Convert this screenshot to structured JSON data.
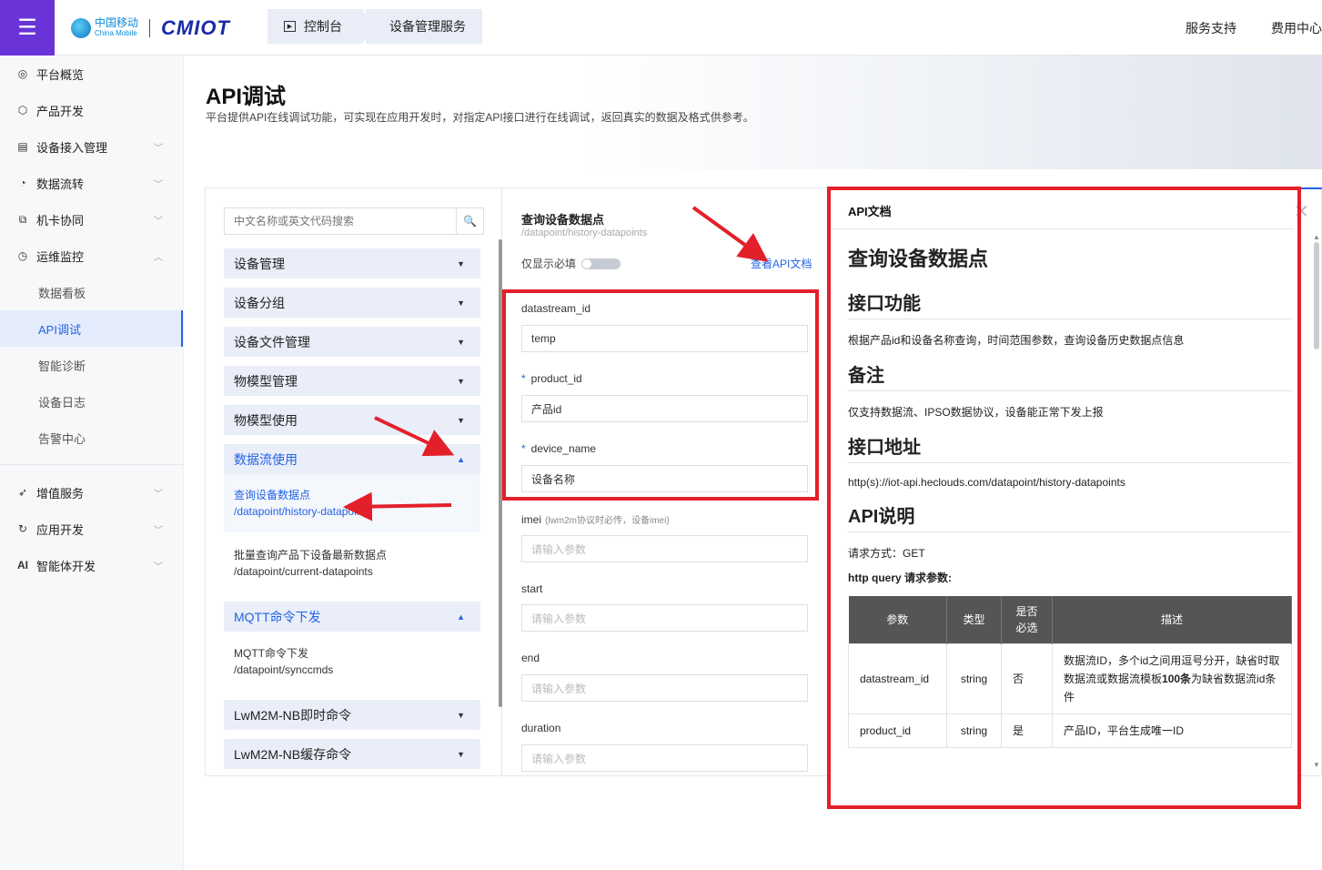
{
  "topbar": {
    "logo_cn": "中国移动",
    "logo_en": "China Mobile",
    "logo_cmiot": "CMIOT",
    "crumbs": [
      "控制台",
      "设备管理服务"
    ],
    "links": [
      "服务支持",
      "费用中心"
    ]
  },
  "sidebar": {
    "items": [
      {
        "label": "平台概览",
        "icon": "overview-icon",
        "chevron": false
      },
      {
        "label": "产品开发",
        "icon": "cube-icon",
        "chevron": false
      },
      {
        "label": "设备接入管理",
        "icon": "device-icon",
        "chevron": true
      },
      {
        "label": "数据流转",
        "icon": "flow-icon",
        "chevron": true
      },
      {
        "label": "机卡协同",
        "icon": "sim-icon",
        "chevron": true
      },
      {
        "label": "运维监控",
        "icon": "monitor-icon",
        "chevron": true,
        "expanded": true
      }
    ],
    "sub_items": [
      "数据看板",
      "API调试",
      "智能诊断",
      "设备日志",
      "告警中心"
    ],
    "active_sub": "API调试",
    "items2": [
      {
        "label": "增值服务",
        "icon": "send-icon"
      },
      {
        "label": "应用开发",
        "icon": "code-icon"
      },
      {
        "label": "智能体开发",
        "icon": "ai-icon"
      }
    ]
  },
  "page": {
    "title": "API调试",
    "desc": "平台提供API在线调试功能，可实现在应用开发时，对指定API接口进行在线调试，返回真实的数据及格式供参考。"
  },
  "left": {
    "search_placeholder": "中文名称或英文代码搜索",
    "groups": [
      "设备管理",
      "设备分组",
      "设备文件管理",
      "物模型管理",
      "物模型使用",
      "数据流使用"
    ],
    "open_items": [
      {
        "name": "查询设备数据点",
        "path": "/datapoint/history-datapoints"
      },
      {
        "name": "批量查询产品下设备最新数据点",
        "path": "/datapoint/current-datapoints"
      }
    ],
    "mqtt_group": "MQTT命令下发",
    "mqtt_item": {
      "name": "MQTT命令下发",
      "path": "/datapoint/synccmds"
    },
    "groups2": [
      "LwM2M-NB即时命令",
      "LwM2M-NB缓存命令"
    ]
  },
  "middle": {
    "title": "查询设备数据点",
    "path": "/datapoint/history-datapoints",
    "required_only": "仅显示必填",
    "api_doc_link": "查看API文档",
    "fields": [
      {
        "label": "datastream_id",
        "value": "temp",
        "required": false,
        "hint": ""
      },
      {
        "label": "product_id",
        "value": "产品id",
        "required": true,
        "hint": ""
      },
      {
        "label": "device_name",
        "value": "设备名称",
        "required": true,
        "hint": ""
      },
      {
        "label": "imei",
        "value": "请输入参数",
        "required": false,
        "hint": "(lwm2m协议时必传，设备imei)"
      },
      {
        "label": "start",
        "value": "请输入参数",
        "required": false,
        "hint": ""
      },
      {
        "label": "end",
        "value": "请输入参数",
        "required": false,
        "hint": ""
      },
      {
        "label": "duration",
        "value": "请输入参数",
        "required": false,
        "hint": ""
      }
    ]
  },
  "doc": {
    "header": "API文档",
    "title": "查询设备数据点",
    "h_func": "接口功能",
    "func": "根据产品id和设备名称查询，时间范围参数，查询设备历史数据点信息",
    "h_note": "备注",
    "note": "仅支持数据流、IPSO数据协议，设备能正常下发上报",
    "h_addr": "接口地址",
    "addr": "http(s)://iot-api.heclouds.com/datapoint/history-datapoints",
    "h_api": "API说明",
    "method": "请求方式：GET",
    "query_title": "http query 请求参数:",
    "table_head": [
      "参数",
      "类型",
      "是否必选",
      "描述"
    ],
    "rows": [
      {
        "param": "datastream_id",
        "type": "string",
        "req": "否",
        "desc_pre": "数据流ID，多个id之间用逗号分开，缺省时取数据流或数据流模板",
        "desc_bold": "100条",
        "desc_post": "为缺省数据流id条件"
      },
      {
        "param": "product_id",
        "type": "string",
        "req": "是",
        "desc_pre": "产品ID，平台生成唯一ID",
        "desc_bold": "",
        "desc_post": ""
      }
    ]
  },
  "colors": {
    "accent": "#2462e6",
    "brand_purple": "#6a33d8",
    "annotation_red": "#e3202a"
  }
}
